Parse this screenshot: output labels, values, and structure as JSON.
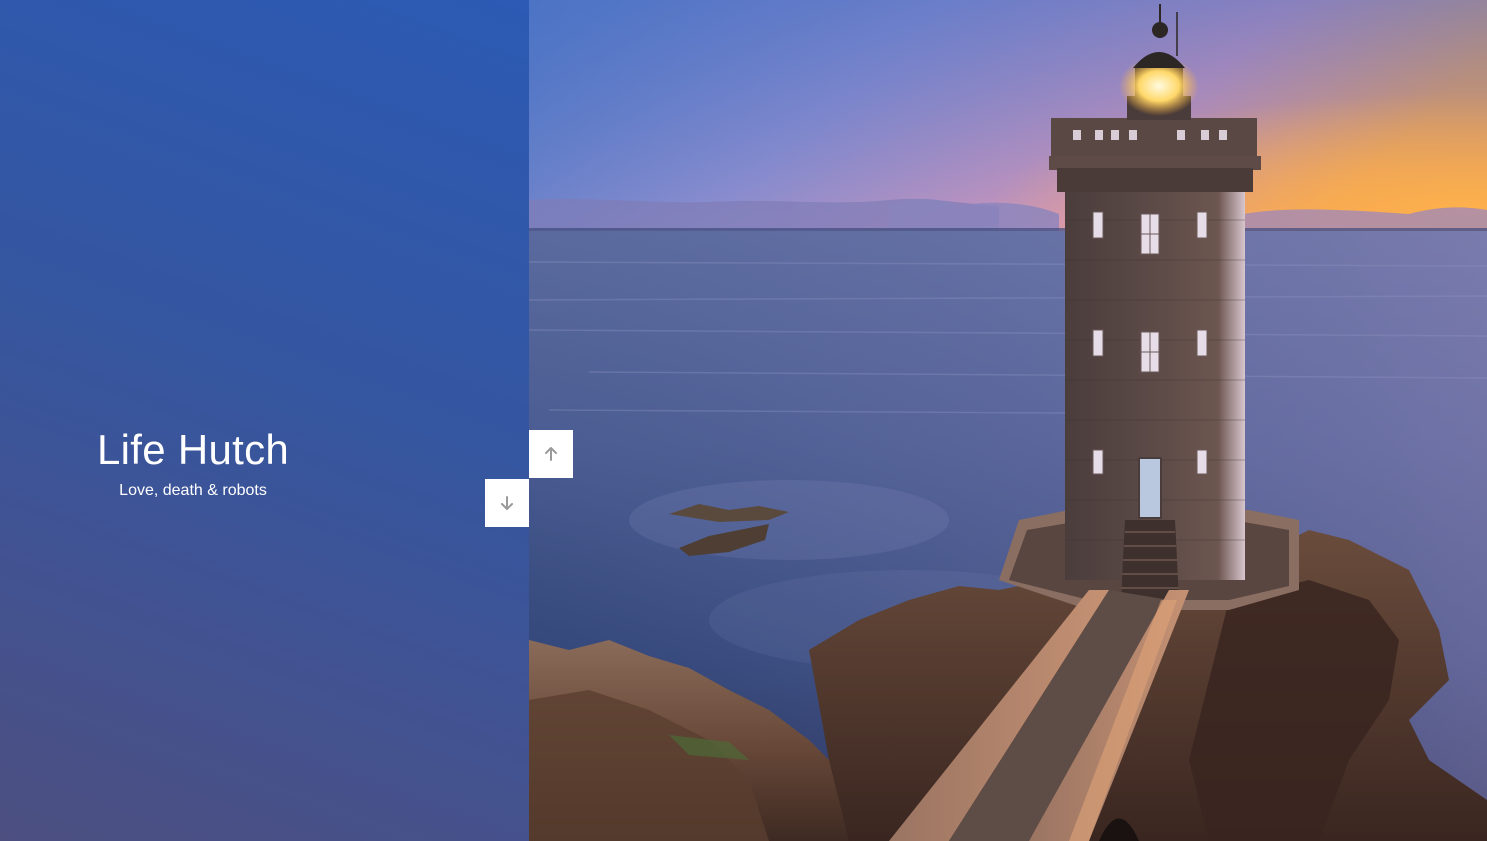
{
  "site": {
    "title": "Life Hutch",
    "tagline": "Love, death & robots"
  },
  "navigation": {
    "up_icon": "arrow-up-icon",
    "down_icon": "arrow-down-icon"
  },
  "colors": {
    "panel_blue": "#2c5ab4",
    "panel_purple": "#4c4f80",
    "text": "#ffffff",
    "icon_gray": "#9a9a9a"
  }
}
